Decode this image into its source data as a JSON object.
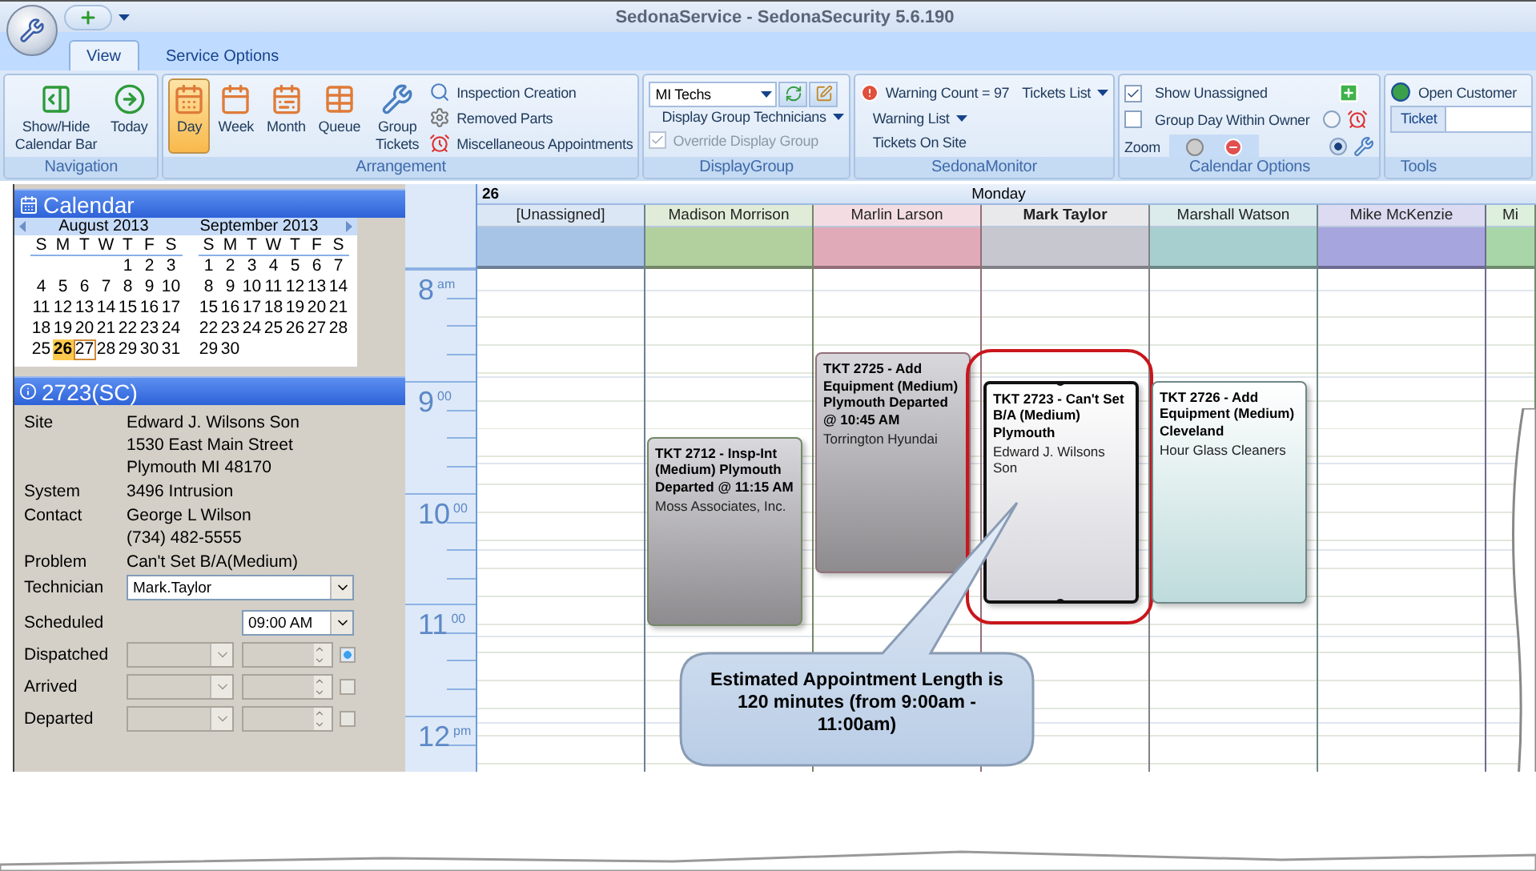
{
  "window": {
    "title": "SedonaService - SedonaSecurity 5.6.190"
  },
  "tabs": [
    {
      "label": "View",
      "selected": true
    },
    {
      "label": "Service Options",
      "selected": false
    }
  ],
  "ribbon": {
    "navigation": {
      "label": "Navigation",
      "buttons": [
        "Show/Hide Calendar Bar",
        "Today"
      ]
    },
    "arrangement": {
      "label": "Arrangement",
      "views": [
        {
          "label": "Day",
          "selected": true
        },
        {
          "label": "Week",
          "selected": false
        },
        {
          "label": "Month",
          "selected": false
        },
        {
          "label": "Queue",
          "selected": false
        }
      ],
      "group_tickets": "Group Tickets",
      "links": [
        "Inspection Creation",
        "Removed Parts",
        "Miscellaneous Appointments"
      ]
    },
    "display_group": {
      "label": "DisplayGroup",
      "select": "MI Techs",
      "menu": "Display Group Technicians",
      "override": {
        "label": "Override Display Group",
        "checked": true,
        "disabled": true
      }
    },
    "monitor": {
      "label": "SedonaMonitor",
      "warning": "Warning Count = 97",
      "tickets_list": "Tickets List",
      "warning_list": "Warning List",
      "on_site": "Tickets On Site"
    },
    "calendar_options": {
      "label": "Calendar Options",
      "show_unassigned": {
        "label": "Show Unassigned",
        "checked": true
      },
      "group_day": {
        "label": "Group Day Within Owner",
        "checked": false
      },
      "zoom": "Zoom",
      "radios": [
        {
          "selected": false
        },
        {
          "selected": true
        }
      ]
    },
    "tools": {
      "label": "Tools",
      "open_customer": "Open Customer",
      "ticket": "Ticket"
    }
  },
  "calendar": {
    "title": "Calendar",
    "months": [
      {
        "title": "August 2013",
        "weekdays": [
          "S",
          "M",
          "T",
          "W",
          "T",
          "F",
          "S"
        ],
        "weeks": [
          [
            {
              "day": "1",
              "selected": false,
              "today": false
            },
            {
              "day": "2",
              "selected": false,
              "today": false
            },
            {
              "day": "3",
              "selected": false,
              "today": false
            }
          ],
          [
            {
              "day": "4",
              "selected": false,
              "today": false
            },
            {
              "day": "5",
              "selected": false,
              "today": false
            },
            {
              "day": "6",
              "selected": false,
              "today": false
            },
            {
              "day": "7",
              "selected": false,
              "today": false
            },
            {
              "day": "8",
              "selected": false,
              "today": false
            },
            {
              "day": "9",
              "selected": false,
              "today": false
            },
            {
              "day": "10",
              "selected": false,
              "today": false
            }
          ],
          [
            {
              "day": "11",
              "selected": false,
              "today": false
            },
            {
              "day": "12",
              "selected": false,
              "today": false
            },
            {
              "day": "13",
              "selected": false,
              "today": false
            },
            {
              "day": "14",
              "selected": false,
              "today": false
            },
            {
              "day": "15",
              "selected": false,
              "today": false
            },
            {
              "day": "16",
              "selected": false,
              "today": false
            },
            {
              "day": "17",
              "selected": false,
              "today": false
            }
          ],
          [
            {
              "day": "18",
              "selected": false,
              "today": false
            },
            {
              "day": "19",
              "selected": false,
              "today": false
            },
            {
              "day": "20",
              "selected": false,
              "today": false
            },
            {
              "day": "21",
              "selected": false,
              "today": false
            },
            {
              "day": "22",
              "selected": false,
              "today": false
            },
            {
              "day": "23",
              "selected": false,
              "today": false
            },
            {
              "day": "24",
              "selected": false,
              "today": false
            }
          ],
          [
            {
              "day": "25",
              "selected": false,
              "today": false
            },
            {
              "day": "26",
              "selected": true,
              "today": false
            },
            {
              "day": "27",
              "selected": false,
              "today": true
            },
            {
              "day": "28",
              "selected": false,
              "today": false
            },
            {
              "day": "29",
              "selected": false,
              "today": false
            },
            {
              "day": "30",
              "selected": false,
              "today": false
            },
            {
              "day": "31",
              "selected": false,
              "today": false
            }
          ]
        ]
      },
      {
        "title": "September 2013",
        "weekdays": [
          "S",
          "M",
          "T",
          "W",
          "T",
          "F",
          "S"
        ],
        "weeks": [
          [
            {
              "day": "1",
              "selected": false,
              "today": false
            },
            {
              "day": "2",
              "selected": false,
              "today": false
            },
            {
              "day": "3",
              "selected": false,
              "today": false
            },
            {
              "day": "4",
              "selected": false,
              "today": false
            },
            {
              "day": "5",
              "selected": false,
              "today": false
            },
            {
              "day": "6",
              "selected": false,
              "today": false
            },
            {
              "day": "7",
              "selected": false,
              "today": false
            }
          ],
          [
            {
              "day": "8",
              "selected": false,
              "today": false
            },
            {
              "day": "9",
              "selected": false,
              "today": false
            },
            {
              "day": "10",
              "selected": false,
              "today": false
            },
            {
              "day": "11",
              "selected": false,
              "today": false
            },
            {
              "day": "12",
              "selected": false,
              "today": false
            },
            {
              "day": "13",
              "selected": false,
              "today": false
            },
            {
              "day": "14",
              "selected": false,
              "today": false
            }
          ],
          [
            {
              "day": "15",
              "selected": false,
              "today": false
            },
            {
              "day": "16",
              "selected": false,
              "today": false
            },
            {
              "day": "17",
              "selected": false,
              "today": false
            },
            {
              "day": "18",
              "selected": false,
              "today": false
            },
            {
              "day": "19",
              "selected": false,
              "today": false
            },
            {
              "day": "20",
              "selected": false,
              "today": false
            },
            {
              "day": "21",
              "selected": false,
              "today": false
            }
          ],
          [
            {
              "day": "22",
              "selected": false,
              "today": false
            },
            {
              "day": "23",
              "selected": false,
              "today": false
            },
            {
              "day": "24",
              "selected": false,
              "today": false
            },
            {
              "day": "25",
              "selected": false,
              "today": false
            },
            {
              "day": "26",
              "selected": false,
              "today": false
            },
            {
              "day": "27",
              "selected": false,
              "today": false
            },
            {
              "day": "28",
              "selected": false,
              "today": false
            }
          ],
          [
            {
              "day": "29",
              "selected": false,
              "today": false
            },
            {
              "day": "30",
              "selected": false,
              "today": false
            }
          ]
        ]
      }
    ]
  },
  "ticket": {
    "title": "2723(SC)",
    "fields": [
      {
        "label": "Site",
        "lines": [
          "Edward J. Wilsons Son",
          "1530 East Main Street",
          "Plymouth MI 48170"
        ]
      },
      {
        "label": "System",
        "lines": [
          "3496 Intrusion"
        ]
      },
      {
        "label": "Contact",
        "lines": [
          "George L Wilson",
          "(734) 482-5555"
        ]
      },
      {
        "label": "Problem",
        "lines": [
          "Can't Set B/A(Medium)"
        ]
      }
    ],
    "technician": {
      "label": "Technician",
      "value": "Mark.Taylor"
    },
    "scheduled": {
      "label": "Scheduled",
      "time": "09:00 AM"
    },
    "status_rows": [
      {
        "label": "Dispatched",
        "active": true
      },
      {
        "label": "Arrived",
        "active": false
      },
      {
        "label": "Departed",
        "active": false
      }
    ]
  },
  "schedule": {
    "day_number": "26",
    "day_name": "Monday",
    "time_labels": [
      {
        "hour": "8",
        "suffix": "am"
      },
      {
        "hour": "9",
        "suffix": "00"
      },
      {
        "hour": "10",
        "suffix": "00"
      },
      {
        "hour": "11",
        "suffix": "00"
      },
      {
        "hour": "12",
        "suffix": "pm"
      }
    ],
    "resources": [
      {
        "name": "[Unassigned]",
        "color": "#a7c4e6",
        "selected": false
      },
      {
        "name": "Madison Morrison",
        "color": "#b2d09e",
        "selected": false,
        "appointments": [
          {
            "title": "TKT 2712 - Insp-Int (Medium) Plymouth Departed @ 11:15 AM",
            "customer": "Moss Associates, Inc.",
            "departed": true,
            "selected": false
          }
        ]
      },
      {
        "name": "Marlin Larson",
        "color": "#e0aab9",
        "selected": false,
        "appointments": [
          {
            "title": "TKT 2725 - Add Equipment (Medium) Plymouth Departed @ 10:45 AM",
            "customer": "Torrington Hyundai",
            "departed": true,
            "selected": false
          }
        ]
      },
      {
        "name": "Mark Taylor",
        "color": "#c7c7cf",
        "selected": true,
        "appointments": [
          {
            "title": "TKT 2723 - Can't Set B/A (Medium) Plymouth",
            "customer": "Edward J. Wilsons Son",
            "departed": false,
            "selected": true
          }
        ]
      },
      {
        "name": "Marshall Watson",
        "color": "#a8cfcf",
        "selected": false,
        "appointments": [
          {
            "title": "TKT 2726 - Add Equipment (Medium) Cleveland",
            "customer": "Hour Glass Cleaners",
            "departed": false,
            "selected": false
          }
        ]
      },
      {
        "name": "Mike McKenzie",
        "color": "#a7a5dd",
        "selected": false
      },
      {
        "name": "Mi",
        "color": "#a9d6a9",
        "selected": false
      }
    ],
    "callout": "Estimated Appointment Length is 120 minutes (from 9:00am - 11:00am)"
  }
}
